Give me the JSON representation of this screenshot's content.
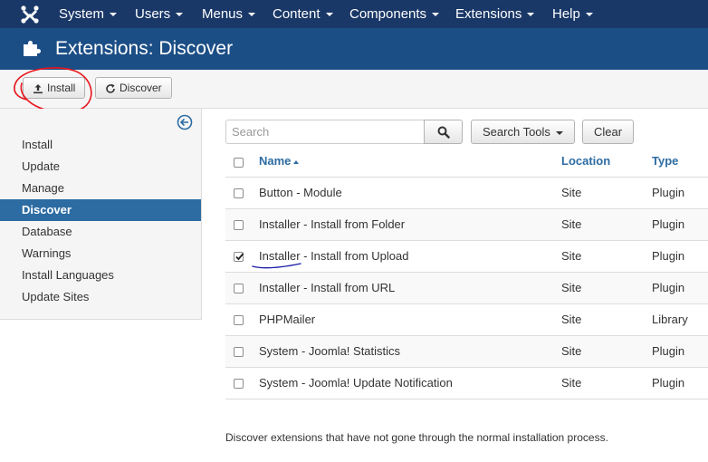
{
  "menu": {
    "items": [
      {
        "label": "System"
      },
      {
        "label": "Users"
      },
      {
        "label": "Menus"
      },
      {
        "label": "Content"
      },
      {
        "label": "Components"
      },
      {
        "label": "Extensions"
      },
      {
        "label": "Help"
      }
    ]
  },
  "header": {
    "title": "Extensions: Discover",
    "icon": "puzzle-icon"
  },
  "toolbar": {
    "install_label": "Install",
    "discover_label": "Discover"
  },
  "sidebar": {
    "items": [
      {
        "label": "Install",
        "active": false
      },
      {
        "label": "Update",
        "active": false
      },
      {
        "label": "Manage",
        "active": false
      },
      {
        "label": "Discover",
        "active": true
      },
      {
        "label": "Database",
        "active": false
      },
      {
        "label": "Warnings",
        "active": false
      },
      {
        "label": "Install Languages",
        "active": false
      },
      {
        "label": "Update Sites",
        "active": false
      }
    ]
  },
  "filters": {
    "search_placeholder": "Search",
    "search_tools_label": "Search Tools",
    "clear_label": "Clear"
  },
  "table": {
    "headers": {
      "name": "Name",
      "location": "Location",
      "type": "Type"
    },
    "rows": [
      {
        "name": "Button - Module",
        "location": "Site",
        "type": "Plugin",
        "checked": false
      },
      {
        "name": "Installer - Install from Folder",
        "location": "Site",
        "type": "Plugin",
        "checked": false
      },
      {
        "name": "Installer - Install from Upload",
        "location": "Site",
        "type": "Plugin",
        "checked": true
      },
      {
        "name": "Installer - Install from URL",
        "location": "Site",
        "type": "Plugin",
        "checked": false
      },
      {
        "name": "PHPMailer",
        "location": "Site",
        "type": "Library",
        "checked": false
      },
      {
        "name": "System - Joomla! Statistics",
        "location": "Site",
        "type": "Plugin",
        "checked": false
      },
      {
        "name": "System - Joomla! Update Notification",
        "location": "Site",
        "type": "Plugin",
        "checked": false
      }
    ]
  },
  "footer": {
    "text": "Discover extensions that have not gone through the normal installation process."
  },
  "colors": {
    "topnav": "#1a3867",
    "titlebar": "#1c4e86",
    "active": "#2d6ca2",
    "annotation_red": "#e8141c",
    "annotation_blue": "#1a1aa8"
  }
}
